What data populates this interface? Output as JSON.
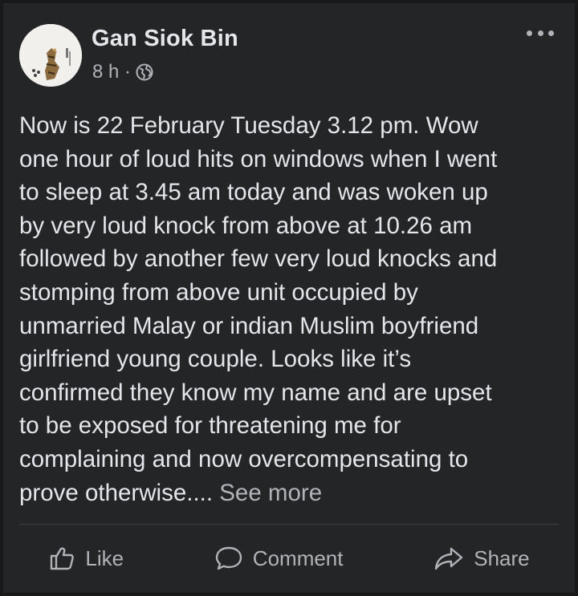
{
  "post": {
    "author": "Gan Siok Bin",
    "time": "8 h ·",
    "privacy_icon": "globe-icon",
    "body": "Now is 22 February Tuesday 3.12 pm. Wow\none hour of loud hits on windows when I went\nto sleep at 3.45 am today and was woken up\nby very loud knock from above at 10.26 am\nfollowed by another few very loud knocks and\nstomping from above unit occupied by\nunmarried Malay or indian Muslim boyfriend\ngirlfriend young couple. Looks like it’s\nconfirmed they know my name and are upset\nto be exposed for threatening me for\ncomplaining and now overcompensating to\nprove otherwise....",
    "see_more": "See more"
  },
  "actions": {
    "like": "Like",
    "comment": "Comment",
    "share": "Share"
  },
  "colors": {
    "background": "#18191a",
    "card": "#242526",
    "primary_text": "#e4e6eb",
    "secondary_text": "#b0b3b8"
  }
}
